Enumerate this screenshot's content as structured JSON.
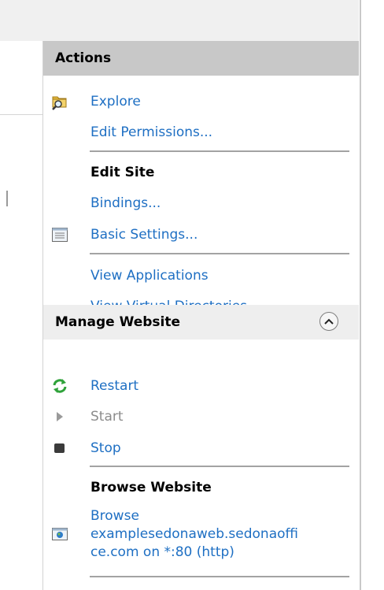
{
  "actions_panel": {
    "header": "Actions",
    "explore": "Explore",
    "edit_permissions": "Edit Permissions...",
    "edit_site": {
      "title": "Edit Site",
      "bindings": "Bindings...",
      "basic_settings": "Basic Settings...",
      "view_applications": "View Applications",
      "view_virtual_directories": "View Virtual Directories"
    },
    "manage_website": {
      "title": "Manage Website",
      "restart": "Restart",
      "start": "Start",
      "stop": "Stop",
      "browse_title": "Browse Website",
      "browse_line1": "Browse",
      "browse_line2": "examplesedonaweb.sedonaoffi",
      "browse_line3": "ce.com on *:80 (http)"
    }
  },
  "icons": {
    "explore": "folder-magnifier-icon",
    "basic_settings": "settings-window-icon",
    "restart": "restart-arrows-icon",
    "start": "start-triangle-icon",
    "stop": "stop-square-icon",
    "browse": "browser-globe-icon",
    "collapse": "chevron-up-icon"
  },
  "colors": {
    "link": "#1e6fc3",
    "disabled_link": "#8c8c8c",
    "header_bg": "#c8c8c8",
    "manage_header_bg": "#eeeeee",
    "restart_green": "#2fa23a"
  }
}
